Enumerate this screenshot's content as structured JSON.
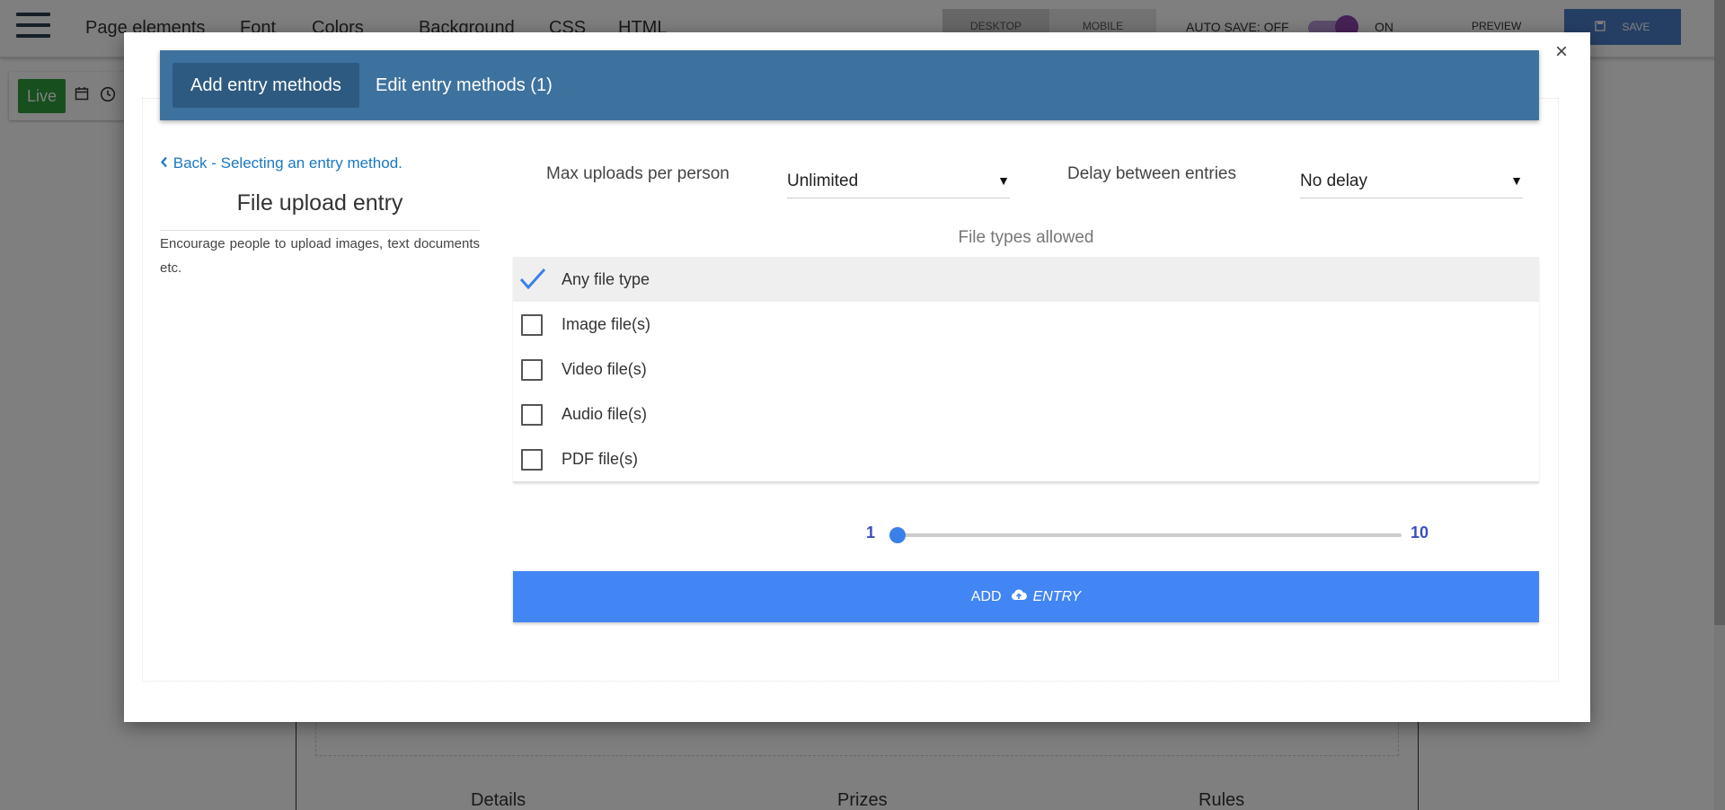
{
  "app": {
    "nav": [
      "Page elements",
      "Font",
      "Colors",
      "Background",
      "CSS",
      "HTML"
    ],
    "device_toggle": {
      "desktop": "DESKTOP",
      "mobile": "MOBILE"
    },
    "autosave_label": "AUTO SAVE: OFF",
    "toggle_on_label": "ON",
    "preview_label": "PREVIEW",
    "save_label": "SAVE",
    "live_label": "Live",
    "page_tabs": [
      "Details",
      "Prizes",
      "Rules"
    ]
  },
  "modal": {
    "close_label": "×",
    "tabs": [
      "Add entry methods",
      "Edit entry methods (1)"
    ],
    "back_link": "Back - Selecting an entry method.",
    "entry_title": "File upload entry",
    "entry_description": "Encourage people to upload images, text documents etc.",
    "max_uploads": {
      "label": "Max uploads per person",
      "value": "Unlimited"
    },
    "delay": {
      "label": "Delay between entries",
      "value": "No delay"
    },
    "file_types_caption": "File types allowed",
    "file_types": [
      {
        "label": "Any file type",
        "checked": true
      },
      {
        "label": "Image file(s)",
        "checked": false
      },
      {
        "label": "Video file(s)",
        "checked": false
      },
      {
        "label": "Audio file(s)",
        "checked": false
      },
      {
        "label": "PDF file(s)",
        "checked": false
      }
    ],
    "slider": {
      "min": "1",
      "max": "10",
      "value": 1
    },
    "add_button": {
      "prefix": "ADD",
      "suffix": "ENTRY"
    }
  },
  "colors": {
    "tabbar": "#3e729e",
    "active_tab": "#2d5a80",
    "link": "#1a78c2",
    "primary_button": "#4285f4",
    "slider_accent": "#3b7fe8"
  }
}
